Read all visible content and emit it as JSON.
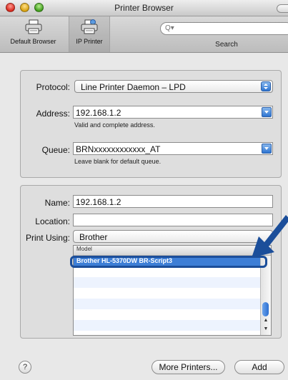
{
  "window": {
    "title": "Printer Browser"
  },
  "toolbar": {
    "default_browser": "Default Browser",
    "ip_printer": "IP Printer",
    "search_label": "Search",
    "search_value": ""
  },
  "form": {
    "protocol_label": "Protocol:",
    "protocol_value": "Line Printer Daemon – LPD",
    "address_label": "Address:",
    "address_value": "192.168.1.2",
    "address_hint": "Valid and complete address.",
    "queue_label": "Queue:",
    "queue_value": "BRNxxxxxxxxxxxx_AT",
    "queue_hint": "Leave blank for default queue."
  },
  "printer": {
    "name_label": "Name:",
    "name_value": "192.168.1.2",
    "location_label": "Location:",
    "location_value": "",
    "print_using_label": "Print Using:",
    "print_using_value": "Brother",
    "model_header": "Model",
    "models": [
      "Brother HL-5370DW BR-Script3"
    ]
  },
  "buttons": {
    "help": "?",
    "more_printers": "More Printers...",
    "add": "Add"
  },
  "colors": {
    "selection": "#3d7ed6",
    "accent": "#2d74d1",
    "annotation_arrow": "#1b4e9a"
  }
}
